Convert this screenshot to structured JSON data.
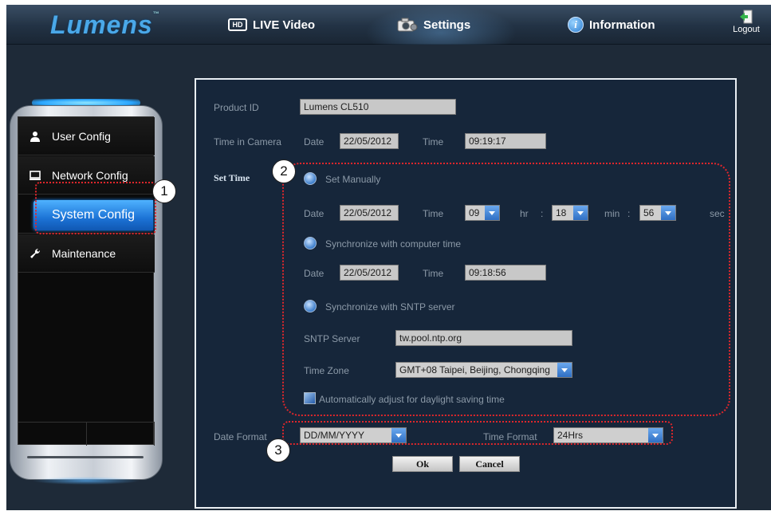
{
  "brand": {
    "logo": "Lumens",
    "tm": "™"
  },
  "nav": {
    "live_video": "LIVE Video",
    "hd_badge": "HD",
    "settings": "Settings",
    "information": "Information",
    "logout": "Logout"
  },
  "sidebar": {
    "items": [
      {
        "label": "User Config",
        "icon": "user-icon"
      },
      {
        "label": "Network Config",
        "icon": "monitor-icon"
      },
      {
        "label": "System Config",
        "icon": "",
        "active": true
      },
      {
        "label": "Maintenance",
        "icon": "wrench-icon"
      }
    ]
  },
  "form": {
    "product_id_label": "Product ID",
    "product_id_value": "Lumens CL510",
    "time_in_camera_label": "Time in Camera",
    "date_label": "Date",
    "time_label": "Time",
    "camera_date": "22/05/2012",
    "camera_time": "09:19:17",
    "set_time_label": "Set Time",
    "set_manually": "Set Manually",
    "manual_date": "22/05/2012",
    "manual_hour": "09",
    "hr_label": "hr",
    "manual_min": "18",
    "min_label": "min",
    "manual_sec": "56",
    "sec_label": "sec",
    "colon": ":",
    "sync_computer": "Synchronize with computer time",
    "computer_date": "22/05/2012",
    "computer_time": "09:18:56",
    "sync_sntp": "Synchronize with SNTP server",
    "sntp_server_label": "SNTP Server",
    "sntp_server_value": "tw.pool.ntp.org",
    "time_zone_label": "Time Zone",
    "time_zone_value": "GMT+08 Taipei, Beijing, Chongqing",
    "dst_label": "Automatically adjust for daylight saving time",
    "date_format_label": "Date Format",
    "date_format_value": "DD/MM/YYYY",
    "time_format_label": "Time Format",
    "time_format_value": "24Hrs",
    "ok": "Ok",
    "cancel": "Cancel"
  },
  "callouts": [
    "1",
    "2",
    "3"
  ],
  "colors": {
    "accent": "#1c73d6",
    "highlight": "#e0262b",
    "panel": "#16263a"
  }
}
